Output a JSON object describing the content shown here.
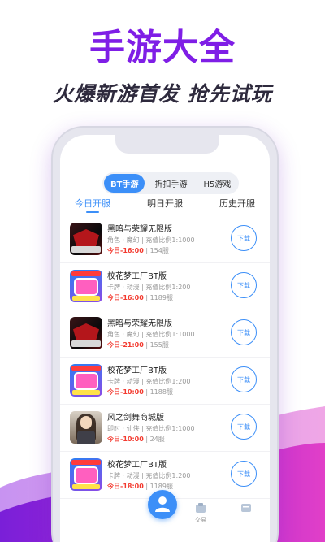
{
  "hero": {
    "title": "手游大全",
    "subtitle": "火爆新游首发 抢先试玩"
  },
  "segment": {
    "items": [
      "BT手游",
      "折扣手游",
      "H5游戏"
    ],
    "active_index": 0
  },
  "tabs": {
    "items": [
      "今日开服",
      "明日开服",
      "历史开服"
    ],
    "active_index": 0
  },
  "games": [
    {
      "name": "黑暗与荣耀无限版",
      "meta": "角色 · 魔幻 | 充值比例1:1000",
      "open_time": "今日-16:00",
      "server": "154服",
      "button": "下载",
      "icon": "dark-glory-game-icon"
    },
    {
      "name": "校花梦工厂BT版",
      "meta": "卡牌 · 动漫 | 充值比例1:200",
      "open_time": "今日-16:00",
      "server": "1189服",
      "button": "下载",
      "icon": "school-girl-game-icon"
    },
    {
      "name": "黑暗与荣耀无限版",
      "meta": "角色 · 魔幻 | 充值比例1:1000",
      "open_time": "今日-21:00",
      "server": "155服",
      "button": "下载",
      "icon": "dark-glory-game-icon"
    },
    {
      "name": "校花梦工厂BT版",
      "meta": "卡牌 · 动漫 | 充值比例1:200",
      "open_time": "今日-10:00",
      "server": "1188服",
      "button": "下载",
      "icon": "school-girl-game-icon"
    },
    {
      "name": "风之剑舞商城版",
      "meta": "即时 · 仙侠 | 充值比例1:1000",
      "open_time": "今日-10:00",
      "server": "24服",
      "button": "下载",
      "icon": "wind-sword-game-icon"
    },
    {
      "name": "校花梦工厂BT版",
      "meta": "卡牌 · 动漫 | 充值比例1:200",
      "open_time": "今日-18:00",
      "server": "1189服",
      "button": "下载",
      "icon": "school-girl-game-icon"
    }
  ],
  "tabbar": {
    "trade_label": "交易"
  },
  "colors": {
    "accent": "#3c8ff8",
    "title_purple": "#7f1ee6",
    "open_time_red": "#f33a2f"
  }
}
